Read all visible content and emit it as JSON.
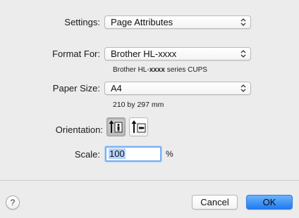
{
  "settings": {
    "label": "Settings:",
    "value": "Page Attributes"
  },
  "format_for": {
    "label": "Format For:",
    "value": "Brother HL-xxxx",
    "sub_prefix": "Brother HL-",
    "sub_bold": "xxxx",
    "sub_suffix": " series CUPS"
  },
  "paper_size": {
    "label": "Paper Size:",
    "value": "A4",
    "dimensions": "210 by 297 mm"
  },
  "orientation": {
    "label": "Orientation:",
    "options": [
      "portrait",
      "landscape"
    ],
    "selected": "portrait"
  },
  "scale": {
    "label": "Scale:",
    "value": "100",
    "unit": "%"
  },
  "footer": {
    "help_symbol": "?",
    "cancel_label": "Cancel",
    "ok_label": "OK"
  },
  "colors": {
    "background": "#ececec",
    "accent": "#1f7bf2",
    "focus_ring": "#7aaef2"
  }
}
